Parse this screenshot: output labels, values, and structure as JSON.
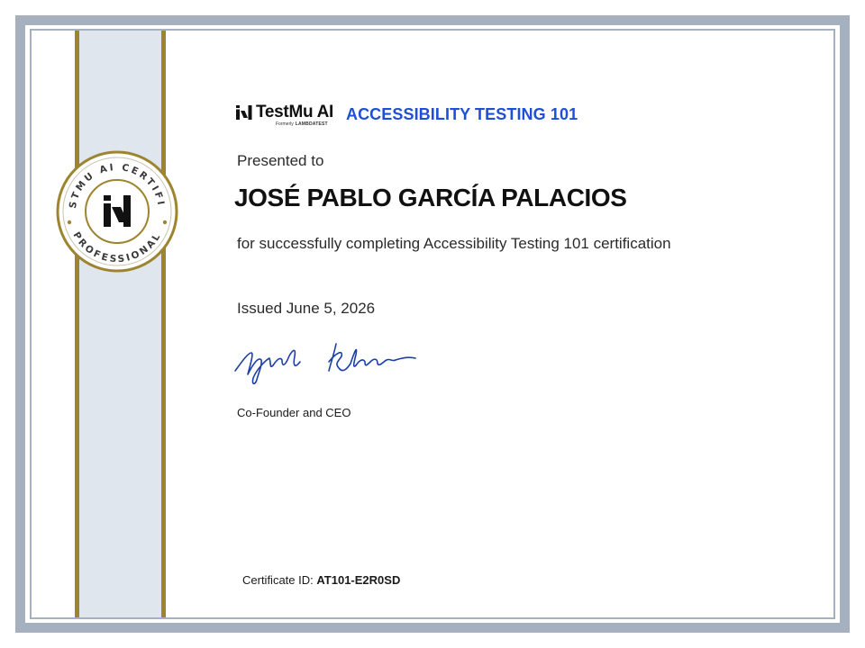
{
  "certificate": {
    "brand_name": "TestMu AI",
    "brand_sub_prefix": "Formerly",
    "brand_sub_logo": "LAMBDATEST",
    "course_title": "ACCESSIBILITY TESTING 101",
    "presented_to": "Presented to",
    "recipient": "JOSÉ PABLO GARCÍA PALACIOS",
    "description": "for successfully completing Accessibility Testing 101 certification",
    "issued": "Issued June 5, 2026",
    "signer_title": "Co-Founder and CEO",
    "certificate_id_label": "Certificate ID:",
    "certificate_id_value": "AT101-E2R0SD"
  },
  "seal": {
    "top_text": "TESTMU AI CERTIFIED",
    "bottom_text": "PROFESSIONAL"
  },
  "colors": {
    "frame": "#a5b1bf",
    "ribbon": "#dfe6ee",
    "gold": "#9d8530",
    "accent": "#1e4fd6",
    "signature": "#1c3fa8"
  },
  "icons": {
    "brand_logo": "testmu-logo-icon",
    "seal_logo": "testmu-seal-icon"
  }
}
